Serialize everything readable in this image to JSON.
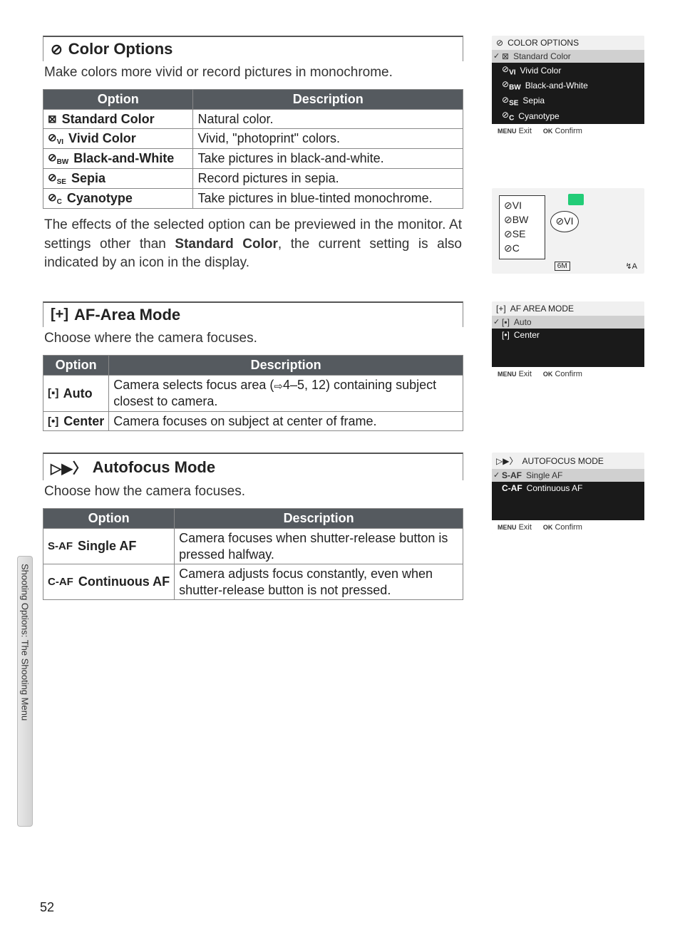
{
  "page_number": "52",
  "side_tab": "Shooting Options: The Shooting Menu",
  "sections": [
    {
      "id": "color",
      "icon": "⊘",
      "title": "Color Options",
      "desc": "Make colors more vivid or record pictures in monochrome.",
      "below_text": "The effects of the selected option can be previewed in the monitor. At settings other than ",
      "below_bold": "Standard Color",
      "below_after": ", the current setting is also indicated by an icon in the display.",
      "headers": {
        "opt": "Option",
        "desc": "Description"
      },
      "rows": [
        {
          "icon": "⊠",
          "label": "Standard Color",
          "desc": "Natural color."
        },
        {
          "icon": "⊘",
          "sub": "VI",
          "label": "Vivid Color",
          "desc": "Vivid, \"photoprint\" colors."
        },
        {
          "icon": "⊘",
          "sub": "BW",
          "label": "Black-and-White",
          "desc": "Take pictures in black-and-white."
        },
        {
          "icon": "⊘",
          "sub": "SE",
          "label": "Sepia",
          "desc": "Record pictures in sepia."
        },
        {
          "icon": "⊘",
          "sub": "C",
          "label": "Cyanotype",
          "desc": "Take pictures in blue-tinted monochrome."
        }
      ],
      "screen": {
        "title": "COLOR OPTIONS",
        "items": [
          {
            "icon": "⊠",
            "label": "Standard Color",
            "sel": true,
            "hl": true
          },
          {
            "icon": "⊘",
            "sub": "VI",
            "label": "Vivid Color"
          },
          {
            "icon": "⊘",
            "sub": "BW",
            "label": "Black-and-White"
          },
          {
            "icon": "⊘",
            "sub": "SE",
            "label": "Sepia"
          },
          {
            "icon": "⊘",
            "sub": "C",
            "label": "Cyanotype"
          }
        ],
        "footer": {
          "exit_key": "MENU",
          "exit": "Exit",
          "ok_key": "OK",
          "ok": "Confirm"
        }
      },
      "preview": {
        "icons": [
          "⊘VI",
          "⊘BW",
          "⊘SE",
          "⊘C"
        ],
        "callout": "⊘VI",
        "bottom_left": "6M",
        "bottom_right": "↯A"
      }
    },
    {
      "id": "afarea",
      "icon": "[+]",
      "title": "AF-Area Mode",
      "desc": "Choose where the camera focuses.",
      "headers": {
        "opt": "Option",
        "desc": "Description"
      },
      "rows": [
        {
          "icon": "[▪]",
          "label": "Auto",
          "desc_pre": "Camera selects focus area (",
          "link": "⇨",
          "pages": "4–5, 12",
          "desc_post": ") containing subject closest to camera."
        },
        {
          "icon": "[•]",
          "label": "Center",
          "desc": "Camera focuses on subject at center of frame."
        }
      ],
      "screen": {
        "title": "AF AREA MODE",
        "items": [
          {
            "icon": "[▪]",
            "label": "Auto",
            "sel": true,
            "hl": true
          },
          {
            "icon": "[•]",
            "label": "Center"
          }
        ],
        "footer": {
          "exit_key": "MENU",
          "exit": "Exit",
          "ok_key": "OK",
          "ok": "Confirm"
        }
      }
    },
    {
      "id": "af",
      "icon": "▷▶〉",
      "title": "Autofocus Mode",
      "desc": "Choose how the camera focuses.",
      "headers": {
        "opt": "Option",
        "desc": "Description"
      },
      "rows": [
        {
          "icon": "S-AF",
          "label": "Single AF",
          "desc": "Camera focuses when shutter-release button is pressed halfway."
        },
        {
          "icon": "C-AF",
          "label": "Continuous AF",
          "desc": "Camera adjusts focus constantly, even when shutter-release button is not pressed."
        }
      ],
      "screen": {
        "title": "AUTOFOCUS MODE",
        "items": [
          {
            "icon": "S-AF",
            "label": "Single AF",
            "sel": true,
            "hl": true
          },
          {
            "icon": "C-AF",
            "label": "Continuous AF"
          }
        ],
        "footer": {
          "exit_key": "MENU",
          "exit": "Exit",
          "ok_key": "OK",
          "ok": "Confirm"
        }
      }
    }
  ]
}
